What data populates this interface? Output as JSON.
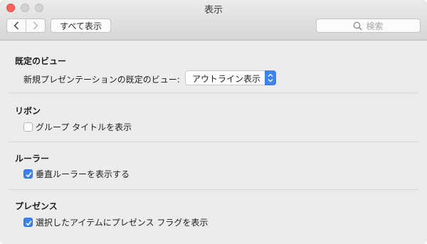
{
  "window": {
    "title": "表示"
  },
  "toolbar": {
    "back_icon": "chevron-left-icon",
    "forward_icon": "chevron-right-icon",
    "show_all_label": "すべて表示",
    "search_placeholder": "検索",
    "search_icon": "search-icon"
  },
  "sections": {
    "default_view": {
      "title": "既定のビュー",
      "label": "新規プレゼンテーションの既定のビュー:",
      "selected_value": "アウトライン表示"
    },
    "ribbon": {
      "title": "リボン",
      "option_label": "グループ タイトルを表示",
      "checked": false
    },
    "ruler": {
      "title": "ルーラー",
      "option_label": "垂直ルーラーを表示する",
      "checked": true
    },
    "presence": {
      "title": "プレゼンス",
      "option_label": "選択したアイテムにプレゼンス フラグを表示",
      "checked": true
    }
  },
  "colors": {
    "accent": "#3d82f2",
    "close_button": "#fc605b"
  }
}
